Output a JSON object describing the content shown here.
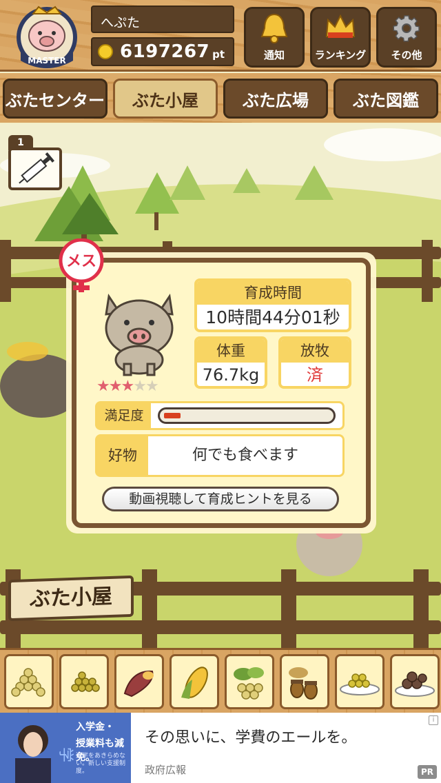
{
  "header": {
    "badge_label": "MASTER",
    "player_name": "へぷた",
    "points_value": "6197267",
    "points_unit": "pt",
    "buttons": [
      {
        "label": "通知",
        "icon": "bell-icon"
      },
      {
        "label": "ランキング",
        "icon": "crown-icon"
      },
      {
        "label": "その他",
        "icon": "gear-icon"
      }
    ]
  },
  "tabs": [
    {
      "label": "ぶたセンター",
      "active": false
    },
    {
      "label": "ぶた小屋",
      "active": true
    },
    {
      "label": "ぶた広場",
      "active": false
    },
    {
      "label": "ぶた図鑑",
      "active": false
    }
  ],
  "item": {
    "count": "1",
    "icon": "syringe-icon"
  },
  "pig_info": {
    "gender_label": "メス",
    "gender_color": "#e0304a",
    "rating": 3,
    "rating_max": 5,
    "growth_time_label": "育成時間",
    "growth_time_value": "10時間44分01秒",
    "weight_label": "体重",
    "weight_value": "76.7kg",
    "grazing_label": "放牧",
    "grazing_value": "済",
    "satisfaction_label": "満足度",
    "satisfaction_level": 0.1,
    "favorite_label": "好物",
    "favorite_value": "何でも食べます",
    "hint_button_label": "動画視聴して育成ヒントを見る"
  },
  "scene": {
    "sign_label": "ぶた小屋"
  },
  "food_items": [
    {
      "icon": "soybeans-icon"
    },
    {
      "icon": "grain-icon"
    },
    {
      "icon": "sweet-potato-icon"
    },
    {
      "icon": "corn-icon"
    },
    {
      "icon": "vegetables-icon"
    },
    {
      "icon": "acorns-icon"
    },
    {
      "icon": "rice-dish-icon"
    },
    {
      "icon": "meatballs-icon"
    }
  ],
  "ad": {
    "image_text_1": "入学金・",
    "image_text_2": "授業料も減免。",
    "image_text_3": "進学をあきらめない。新しい支援制度。",
    "title": "その思いに、学費のエールを。",
    "sponsor": "政府広報",
    "pr_label": "PR",
    "info_label": "i"
  },
  "colors": {
    "wood": "#d9a563",
    "wood_dark": "#5a4026",
    "panel_yellow": "#f8d563",
    "grass": "#c9d56b"
  }
}
